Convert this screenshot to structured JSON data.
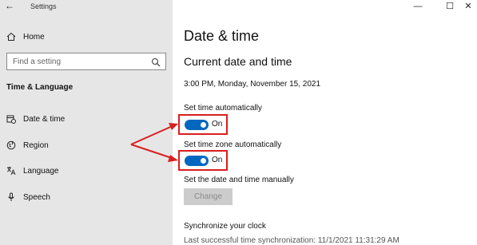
{
  "window": {
    "app_title": "Settings",
    "controls": {
      "minimize": "—",
      "maximize": "☐",
      "close": "✕"
    }
  },
  "sidebar": {
    "home_label": "Home",
    "search_placeholder": "Find a setting",
    "section_title": "Time & Language",
    "items": [
      {
        "label": "Date & time",
        "icon": "calendar-clock-icon"
      },
      {
        "label": "Region",
        "icon": "globe-icon"
      },
      {
        "label": "Language",
        "icon": "language-icon"
      },
      {
        "label": "Speech",
        "icon": "microphone-icon"
      }
    ]
  },
  "main": {
    "title": "Date & time",
    "subheading": "Current date and time",
    "current_datetime": "3:00 PM, Monday, November 15, 2021",
    "set_time_auto": {
      "label": "Set time automatically",
      "state": "On"
    },
    "set_timezone_auto": {
      "label": "Set time zone automatically",
      "state": "On"
    },
    "manual": {
      "label": "Set the date and time manually",
      "button": "Change"
    },
    "sync": {
      "heading": "Synchronize your clock",
      "last_sync": "Last successful time synchronization: 11/1/2021 11:31:29 AM"
    }
  },
  "colors": {
    "toggle_on": "#0067c0",
    "highlight_red": "#d81f1f",
    "sidebar_bg": "#e6e6e6"
  }
}
